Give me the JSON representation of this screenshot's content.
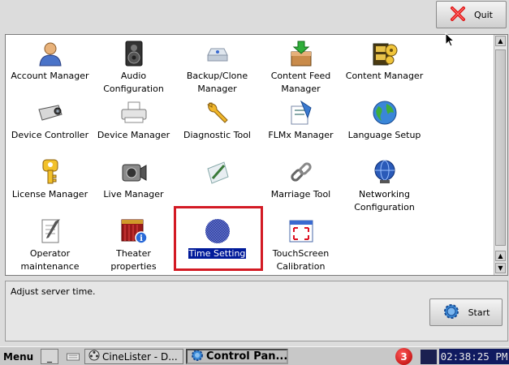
{
  "toolbar": {
    "quit_label": "Quit"
  },
  "apps": [
    {
      "label": "Account Manager",
      "icon": "user-icon"
    },
    {
      "label": "Audio Configuration",
      "icon": "speaker-icon"
    },
    {
      "label": "Backup/Clone Manager",
      "icon": "disk-icon"
    },
    {
      "label": "Content Feed Manager",
      "icon": "feed-icon"
    },
    {
      "label": "Content Manager",
      "icon": "film-icon"
    },
    {
      "label": "Device Controller",
      "icon": "projector-icon"
    },
    {
      "label": "Device Manager",
      "icon": "printer-icon"
    },
    {
      "label": "Diagnostic Tool",
      "icon": "wrench-icon"
    },
    {
      "label": "FLMx Manager",
      "icon": "flmx-icon"
    },
    {
      "label": "Language Setup",
      "icon": "globe-icon"
    },
    {
      "label": "License Manager",
      "icon": "key-icon"
    },
    {
      "label": "Live Manager",
      "icon": "camera-icon"
    },
    {
      "label": "",
      "icon": "pen-icon"
    },
    {
      "label": "Marriage Tool",
      "icon": "chain-icon"
    },
    {
      "label": "Networking Configuration",
      "icon": "network-globe-icon"
    },
    {
      "label": "Operator maintenance",
      "icon": "notepad-icon"
    },
    {
      "label": "Theater properties",
      "icon": "theater-icon"
    },
    {
      "label": "Time Setting",
      "icon": "clock-icon",
      "selected": true
    },
    {
      "label": "TouchScreen Calibration",
      "icon": "calibration-icon"
    }
  ],
  "description": "Adjust server time.",
  "actions": {
    "start_label": "Start"
  },
  "taskbar": {
    "menu_label": "Menu",
    "minimize_label": "_",
    "cinelister_label": "CineLister - D...",
    "control_panel_label": "Control Pan...",
    "notification_count": "3",
    "clock": "02:38:25 PM"
  },
  "colors": {
    "selection": "#001a9a",
    "highlight_box": "#d31a24",
    "clock_bg": "#101a60"
  }
}
